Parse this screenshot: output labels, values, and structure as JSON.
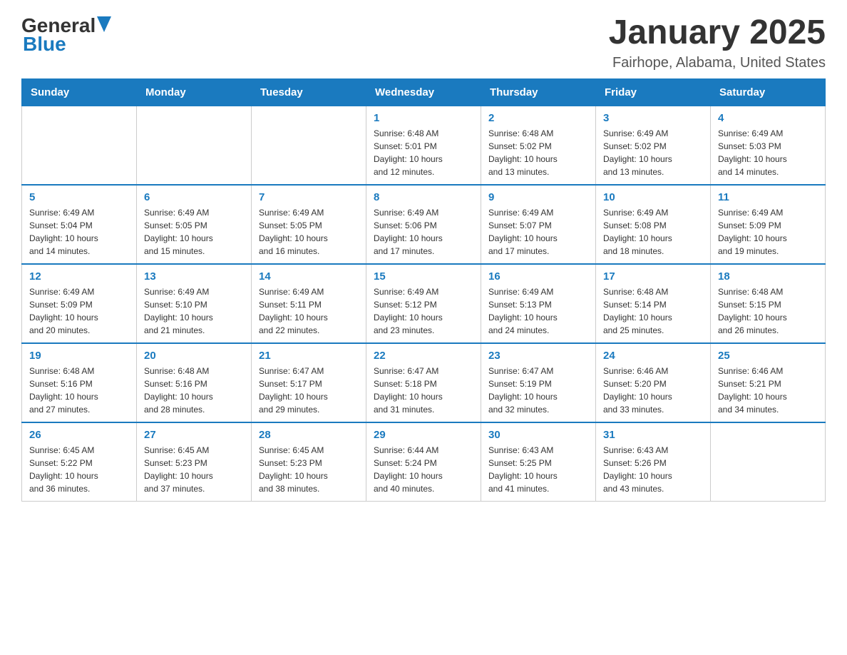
{
  "logo": {
    "text_general": "General",
    "text_blue": "Blue"
  },
  "header": {
    "month": "January 2025",
    "location": "Fairhope, Alabama, United States"
  },
  "days_of_week": [
    "Sunday",
    "Monday",
    "Tuesday",
    "Wednesday",
    "Thursday",
    "Friday",
    "Saturday"
  ],
  "weeks": [
    [
      {
        "day": "",
        "info": ""
      },
      {
        "day": "",
        "info": ""
      },
      {
        "day": "",
        "info": ""
      },
      {
        "day": "1",
        "info": "Sunrise: 6:48 AM\nSunset: 5:01 PM\nDaylight: 10 hours\nand 12 minutes."
      },
      {
        "day": "2",
        "info": "Sunrise: 6:48 AM\nSunset: 5:02 PM\nDaylight: 10 hours\nand 13 minutes."
      },
      {
        "day": "3",
        "info": "Sunrise: 6:49 AM\nSunset: 5:02 PM\nDaylight: 10 hours\nand 13 minutes."
      },
      {
        "day": "4",
        "info": "Sunrise: 6:49 AM\nSunset: 5:03 PM\nDaylight: 10 hours\nand 14 minutes."
      }
    ],
    [
      {
        "day": "5",
        "info": "Sunrise: 6:49 AM\nSunset: 5:04 PM\nDaylight: 10 hours\nand 14 minutes."
      },
      {
        "day": "6",
        "info": "Sunrise: 6:49 AM\nSunset: 5:05 PM\nDaylight: 10 hours\nand 15 minutes."
      },
      {
        "day": "7",
        "info": "Sunrise: 6:49 AM\nSunset: 5:05 PM\nDaylight: 10 hours\nand 16 minutes."
      },
      {
        "day": "8",
        "info": "Sunrise: 6:49 AM\nSunset: 5:06 PM\nDaylight: 10 hours\nand 17 minutes."
      },
      {
        "day": "9",
        "info": "Sunrise: 6:49 AM\nSunset: 5:07 PM\nDaylight: 10 hours\nand 17 minutes."
      },
      {
        "day": "10",
        "info": "Sunrise: 6:49 AM\nSunset: 5:08 PM\nDaylight: 10 hours\nand 18 minutes."
      },
      {
        "day": "11",
        "info": "Sunrise: 6:49 AM\nSunset: 5:09 PM\nDaylight: 10 hours\nand 19 minutes."
      }
    ],
    [
      {
        "day": "12",
        "info": "Sunrise: 6:49 AM\nSunset: 5:09 PM\nDaylight: 10 hours\nand 20 minutes."
      },
      {
        "day": "13",
        "info": "Sunrise: 6:49 AM\nSunset: 5:10 PM\nDaylight: 10 hours\nand 21 minutes."
      },
      {
        "day": "14",
        "info": "Sunrise: 6:49 AM\nSunset: 5:11 PM\nDaylight: 10 hours\nand 22 minutes."
      },
      {
        "day": "15",
        "info": "Sunrise: 6:49 AM\nSunset: 5:12 PM\nDaylight: 10 hours\nand 23 minutes."
      },
      {
        "day": "16",
        "info": "Sunrise: 6:49 AM\nSunset: 5:13 PM\nDaylight: 10 hours\nand 24 minutes."
      },
      {
        "day": "17",
        "info": "Sunrise: 6:48 AM\nSunset: 5:14 PM\nDaylight: 10 hours\nand 25 minutes."
      },
      {
        "day": "18",
        "info": "Sunrise: 6:48 AM\nSunset: 5:15 PM\nDaylight: 10 hours\nand 26 minutes."
      }
    ],
    [
      {
        "day": "19",
        "info": "Sunrise: 6:48 AM\nSunset: 5:16 PM\nDaylight: 10 hours\nand 27 minutes."
      },
      {
        "day": "20",
        "info": "Sunrise: 6:48 AM\nSunset: 5:16 PM\nDaylight: 10 hours\nand 28 minutes."
      },
      {
        "day": "21",
        "info": "Sunrise: 6:47 AM\nSunset: 5:17 PM\nDaylight: 10 hours\nand 29 minutes."
      },
      {
        "day": "22",
        "info": "Sunrise: 6:47 AM\nSunset: 5:18 PM\nDaylight: 10 hours\nand 31 minutes."
      },
      {
        "day": "23",
        "info": "Sunrise: 6:47 AM\nSunset: 5:19 PM\nDaylight: 10 hours\nand 32 minutes."
      },
      {
        "day": "24",
        "info": "Sunrise: 6:46 AM\nSunset: 5:20 PM\nDaylight: 10 hours\nand 33 minutes."
      },
      {
        "day": "25",
        "info": "Sunrise: 6:46 AM\nSunset: 5:21 PM\nDaylight: 10 hours\nand 34 minutes."
      }
    ],
    [
      {
        "day": "26",
        "info": "Sunrise: 6:45 AM\nSunset: 5:22 PM\nDaylight: 10 hours\nand 36 minutes."
      },
      {
        "day": "27",
        "info": "Sunrise: 6:45 AM\nSunset: 5:23 PM\nDaylight: 10 hours\nand 37 minutes."
      },
      {
        "day": "28",
        "info": "Sunrise: 6:45 AM\nSunset: 5:23 PM\nDaylight: 10 hours\nand 38 minutes."
      },
      {
        "day": "29",
        "info": "Sunrise: 6:44 AM\nSunset: 5:24 PM\nDaylight: 10 hours\nand 40 minutes."
      },
      {
        "day": "30",
        "info": "Sunrise: 6:43 AM\nSunset: 5:25 PM\nDaylight: 10 hours\nand 41 minutes."
      },
      {
        "day": "31",
        "info": "Sunrise: 6:43 AM\nSunset: 5:26 PM\nDaylight: 10 hours\nand 43 minutes."
      },
      {
        "day": "",
        "info": ""
      }
    ]
  ]
}
